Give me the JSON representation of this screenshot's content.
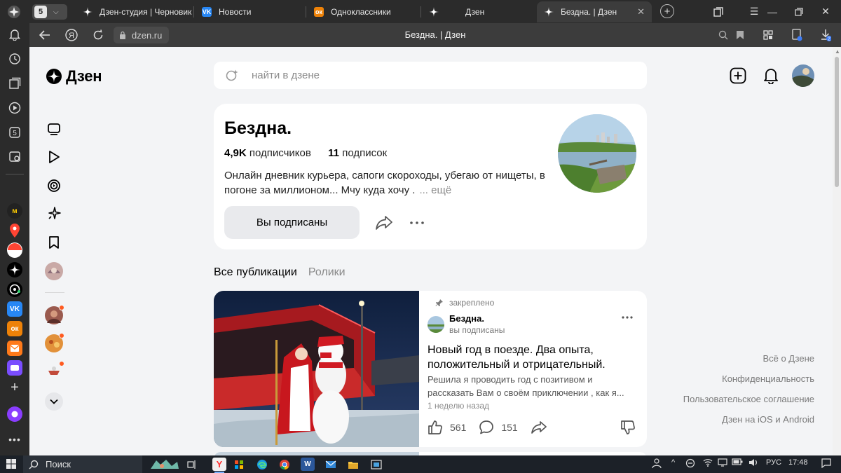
{
  "browser": {
    "tab_count": "5",
    "tabs": [
      {
        "title": "Дзен-студия | Черновик",
        "icon": "zen-icon",
        "active": false
      },
      {
        "title": "Новости",
        "icon": "vk-icon",
        "active": false
      },
      {
        "title": "Одноклассники",
        "icon": "ok-icon",
        "active": false
      },
      {
        "title": "Дзен",
        "icon": "zen-icon",
        "active": false
      },
      {
        "title": "Бездна. | Дзен",
        "icon": "zen-icon",
        "active": true
      }
    ],
    "url": "dzen.ru",
    "page_title": "Бездна. | Дзен",
    "downloads_badge": "2"
  },
  "site": {
    "logo": "Дзен",
    "search_placeholder": "найти в дзене"
  },
  "channel": {
    "name": "Бездна.",
    "subscribers_count": "4,9K",
    "subscribers_label": "подписчиков",
    "subscriptions_count": "11",
    "subscriptions_label": "подписок",
    "description": "Онлайн дневник курьера, сапоги скороходы, убегаю от нищеты, в погоне за миллионом... Мчу куда хочу .",
    "description_more": "... ещё",
    "subscribe_label": "Вы подписаны"
  },
  "content_tabs": [
    {
      "label": "Все публикации",
      "active": true
    },
    {
      "label": "Ролики",
      "active": false
    }
  ],
  "post": {
    "pinned_label": "закреплено",
    "author": "Бездна.",
    "author_status": "вы подписаны",
    "title": "Новый год в поезде. Два опыта, положительный и отрицательный.",
    "excerpt": "Решила я проводить год с позитивом и рассказать Вам о своём приключении , как я...",
    "time": "1 неделю назад",
    "likes": "561",
    "comments": "151"
  },
  "footer": {
    "links": [
      "Всё о Дзене",
      "Конфиденциальность",
      "Пользовательское соглашение",
      "Дзен на iOS и Android"
    ]
  },
  "taskbar": {
    "search_label": "Поиск",
    "language": "РУС",
    "time": "17:48"
  },
  "colors": {
    "chrome_dark": "#2b2b2b",
    "page_bg": "#f3f4f6",
    "card_bg": "#ffffff",
    "accent_orange": "#ff5a1f",
    "vk_blue": "#2787f5",
    "ok_orange": "#ee8208"
  }
}
